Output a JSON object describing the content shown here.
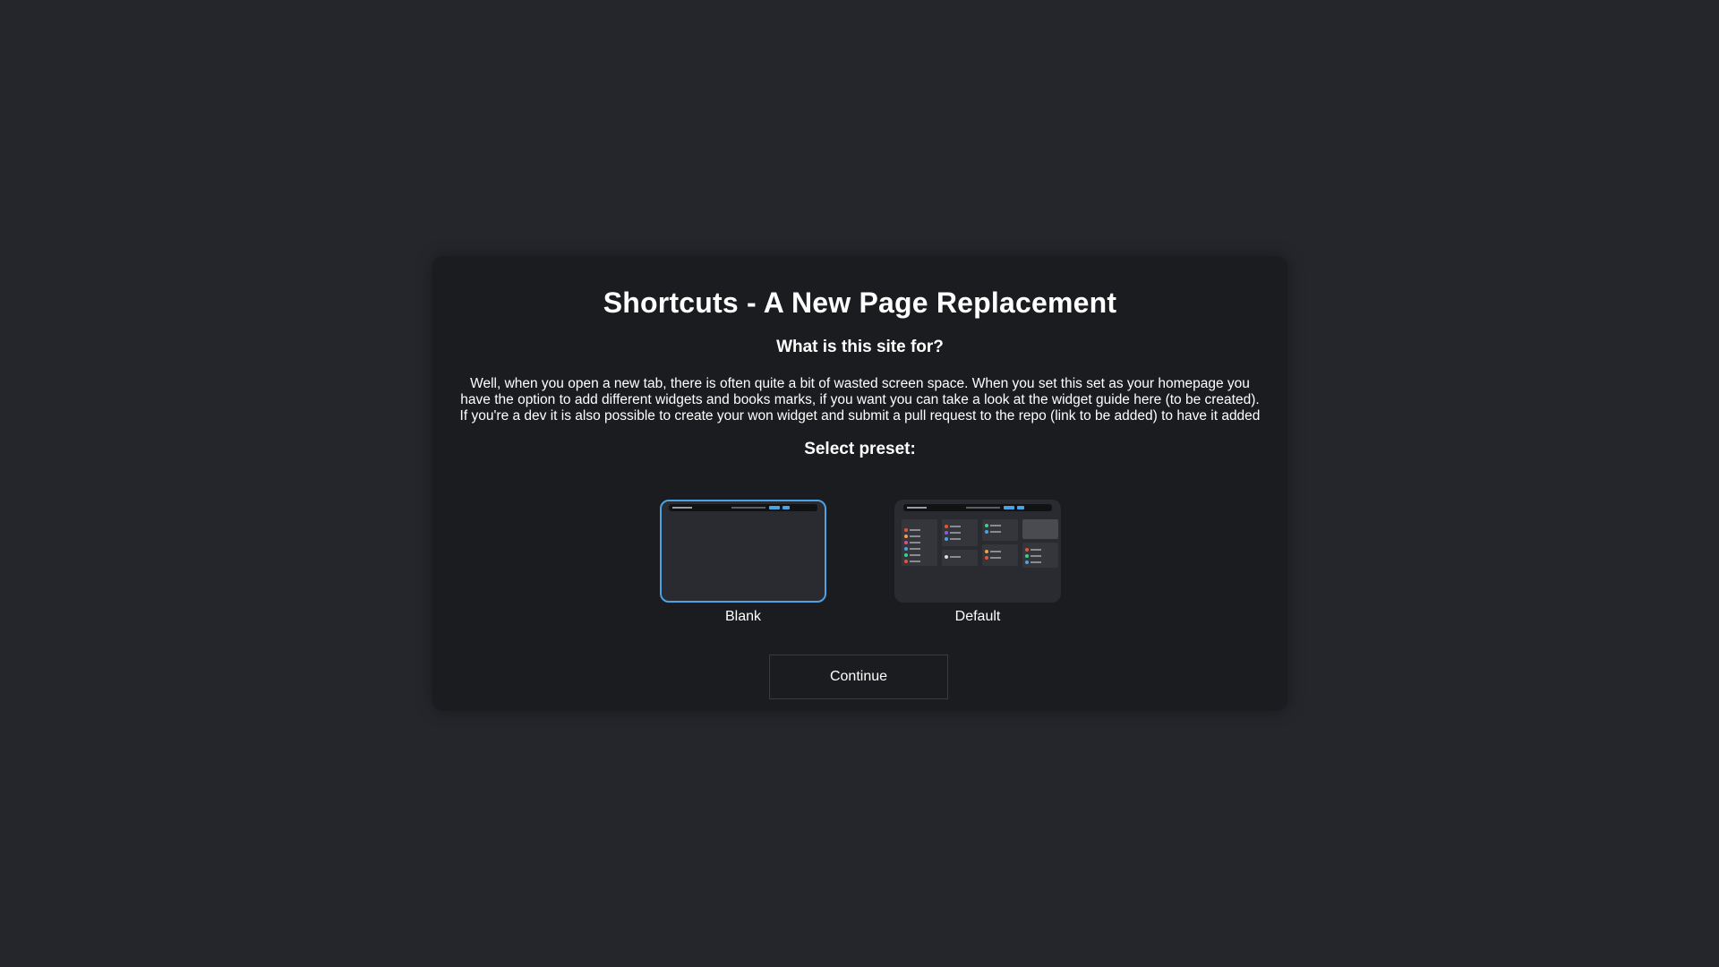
{
  "modal": {
    "title": "Shortcuts - A New Page Replacement",
    "subtitle": "What is this site for?",
    "description_lines": [
      "Well, when you open a new tab, there is often quite a bit of wasted screen space. When you set this set as your homepage you",
      "have the option to add different widgets and books marks, if you want you can take a look at the widget guide here (to be created).",
      "If you're a dev it is also possible to create your won widget and submit a pull request to the repo (link to be added) to have it added"
    ],
    "preset_heading": "Select preset:",
    "presets": [
      {
        "label": "Blank",
        "selected": true
      },
      {
        "label": "Default",
        "selected": false
      }
    ],
    "continue_label": "Continue"
  },
  "colors": {
    "background": "#25262b",
    "modal": "#1b1c1f",
    "accent": "#4ba3e3"
  }
}
